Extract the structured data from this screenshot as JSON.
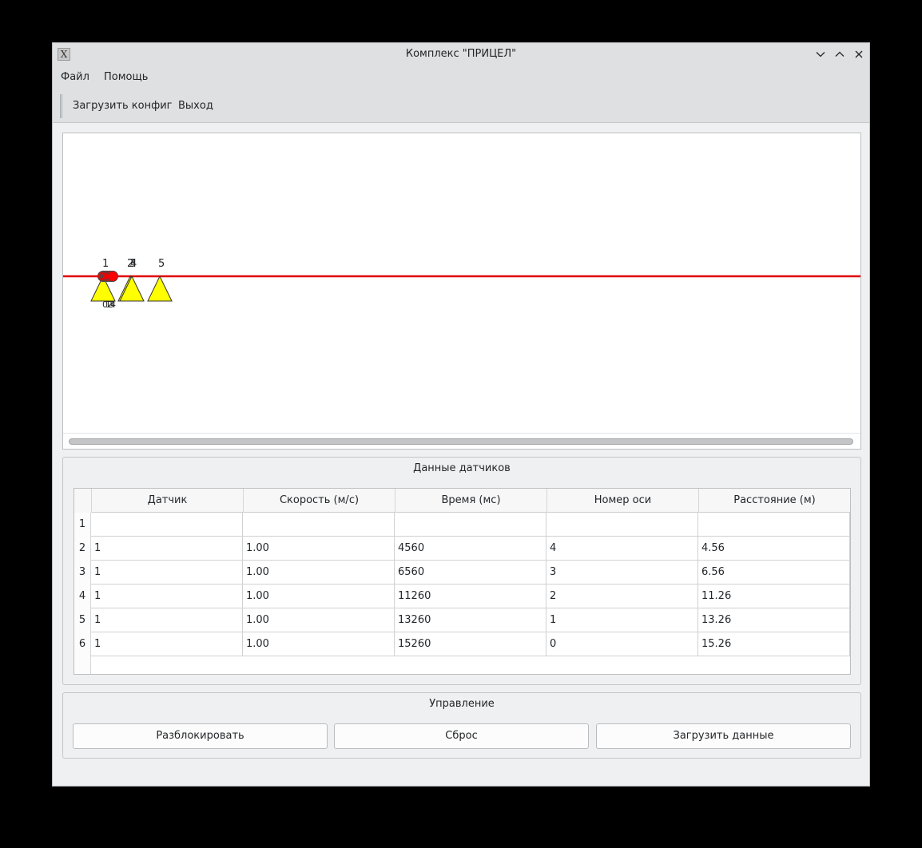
{
  "window": {
    "title": "Комплекс \"ПРИЦЕЛ\"",
    "app_icon_glyph": "X"
  },
  "menubar": {
    "file": "Файл",
    "help": "Помощь"
  },
  "toolbar": {
    "load_config": "Загрузить конфиг",
    "exit": "Выход"
  },
  "scene": {
    "track_color": "#e00000",
    "sensor_fill": "#ffff00",
    "axle_fill": "#ff0000",
    "top_labels": [
      "1",
      "2",
      "3",
      "4",
      "5"
    ],
    "bottom_labels": [
      "0",
      "1",
      "2",
      "3",
      "4"
    ]
  },
  "sensors_group": {
    "title": "Данные датчиков",
    "columns": [
      "Датчик",
      "Скорость (м/с)",
      "Время (мс)",
      "Номер оси",
      "Расстояние (м)"
    ],
    "rows": [
      {
        "n": "1",
        "cells": [
          "",
          "",
          "",
          "",
          ""
        ]
      },
      {
        "n": "2",
        "cells": [
          "1",
          "1.00",
          "4560",
          "4",
          "4.56"
        ]
      },
      {
        "n": "3",
        "cells": [
          "1",
          "1.00",
          "6560",
          "3",
          "6.56"
        ]
      },
      {
        "n": "4",
        "cells": [
          "1",
          "1.00",
          "11260",
          "2",
          "11.26"
        ]
      },
      {
        "n": "5",
        "cells": [
          "1",
          "1.00",
          "13260",
          "1",
          "13.26"
        ]
      },
      {
        "n": "6",
        "cells": [
          "1",
          "1.00",
          "15260",
          "0",
          "15.26"
        ]
      }
    ]
  },
  "control_group": {
    "title": "Управление",
    "unlock": "Разблокировать",
    "reset": "Сброс",
    "load_data": "Загрузить данные"
  }
}
